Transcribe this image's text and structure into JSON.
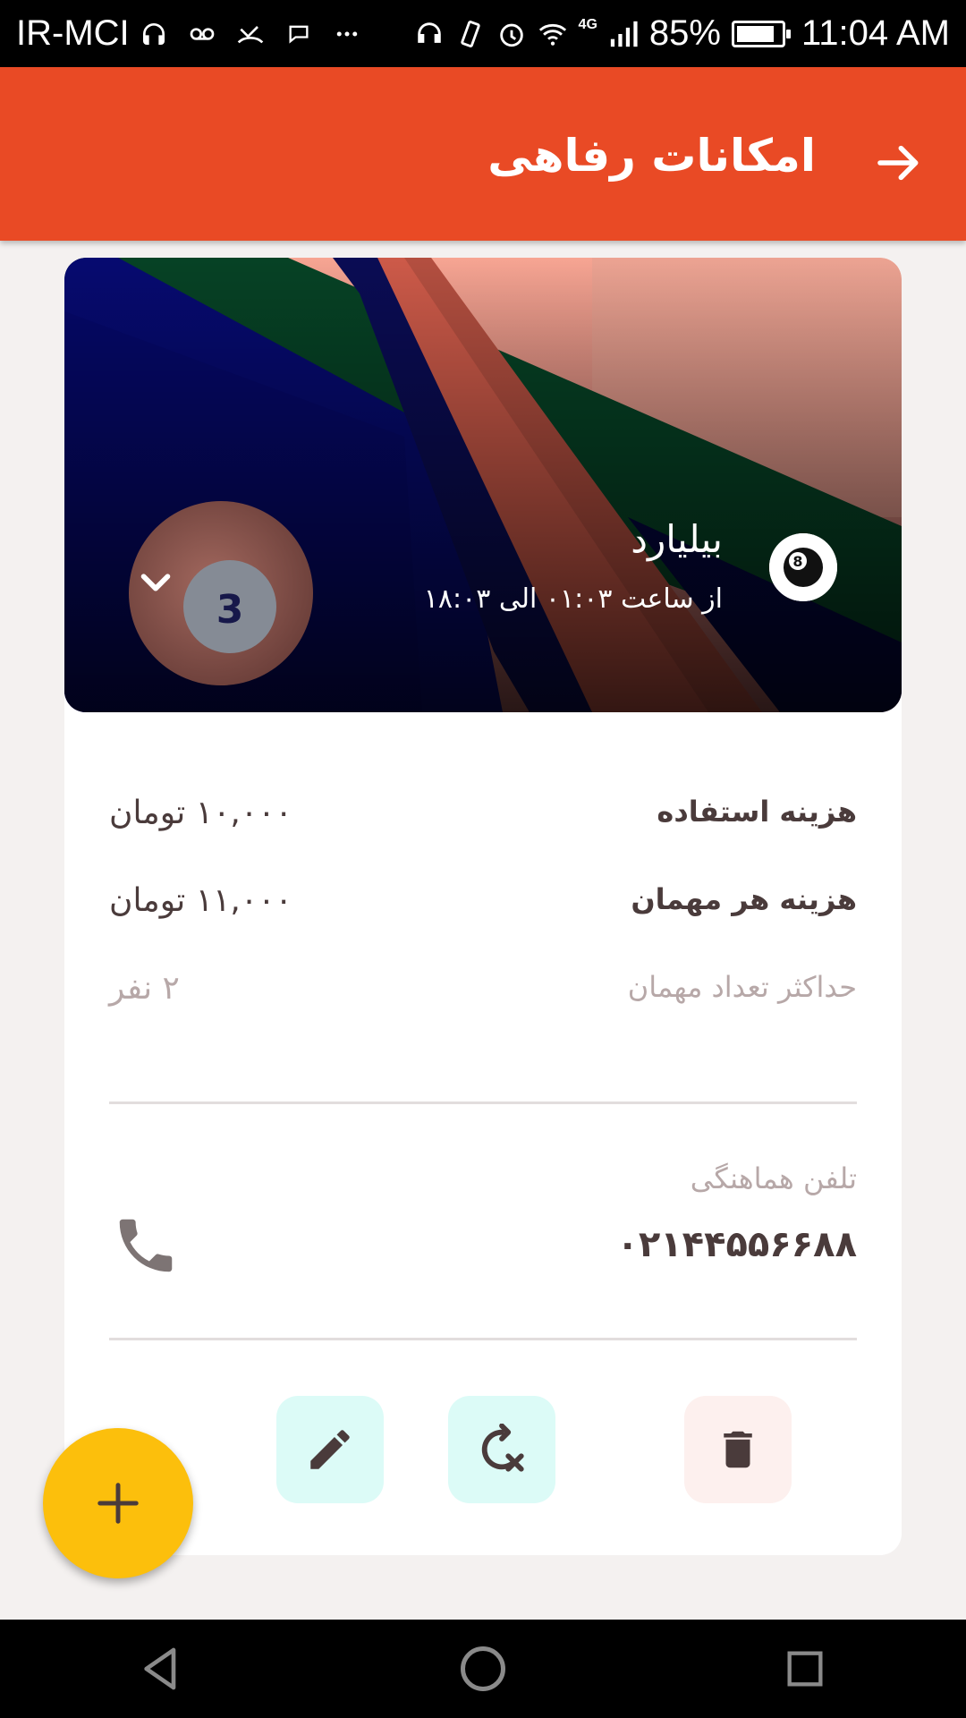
{
  "status_bar": {
    "carrier": "IR-MCI",
    "network": "4G",
    "battery_percent": "85%",
    "battery_level": 0.85,
    "time": "11:04 AM"
  },
  "app_bar": {
    "title": "امکانات رفاهی"
  },
  "facility": {
    "name": "بیلیارد",
    "hours": "از ساعت ۰۱:۰۳ الی ۱۸:۰۳",
    "ball_number": "3",
    "eight_ball": "8"
  },
  "details": [
    {
      "label": "هزینه استفاده",
      "value": "۱۰,۰۰۰ تومان"
    },
    {
      "label": "هزینه هر مهمان",
      "value": "۱۱,۰۰۰ تومان"
    },
    {
      "label": "حداکثر تعداد مهمان",
      "value": "۲ نفر"
    }
  ],
  "contact": {
    "label": "تلفن هماهنگی",
    "phone": "۰۲۱۴۴۵۵۶۶۸۸"
  },
  "colors": {
    "app_bar": "#e94a25",
    "fab": "#fcbf0c",
    "edit_bg": "#dcfbf7",
    "delete_bg": "#fdf0ee"
  }
}
